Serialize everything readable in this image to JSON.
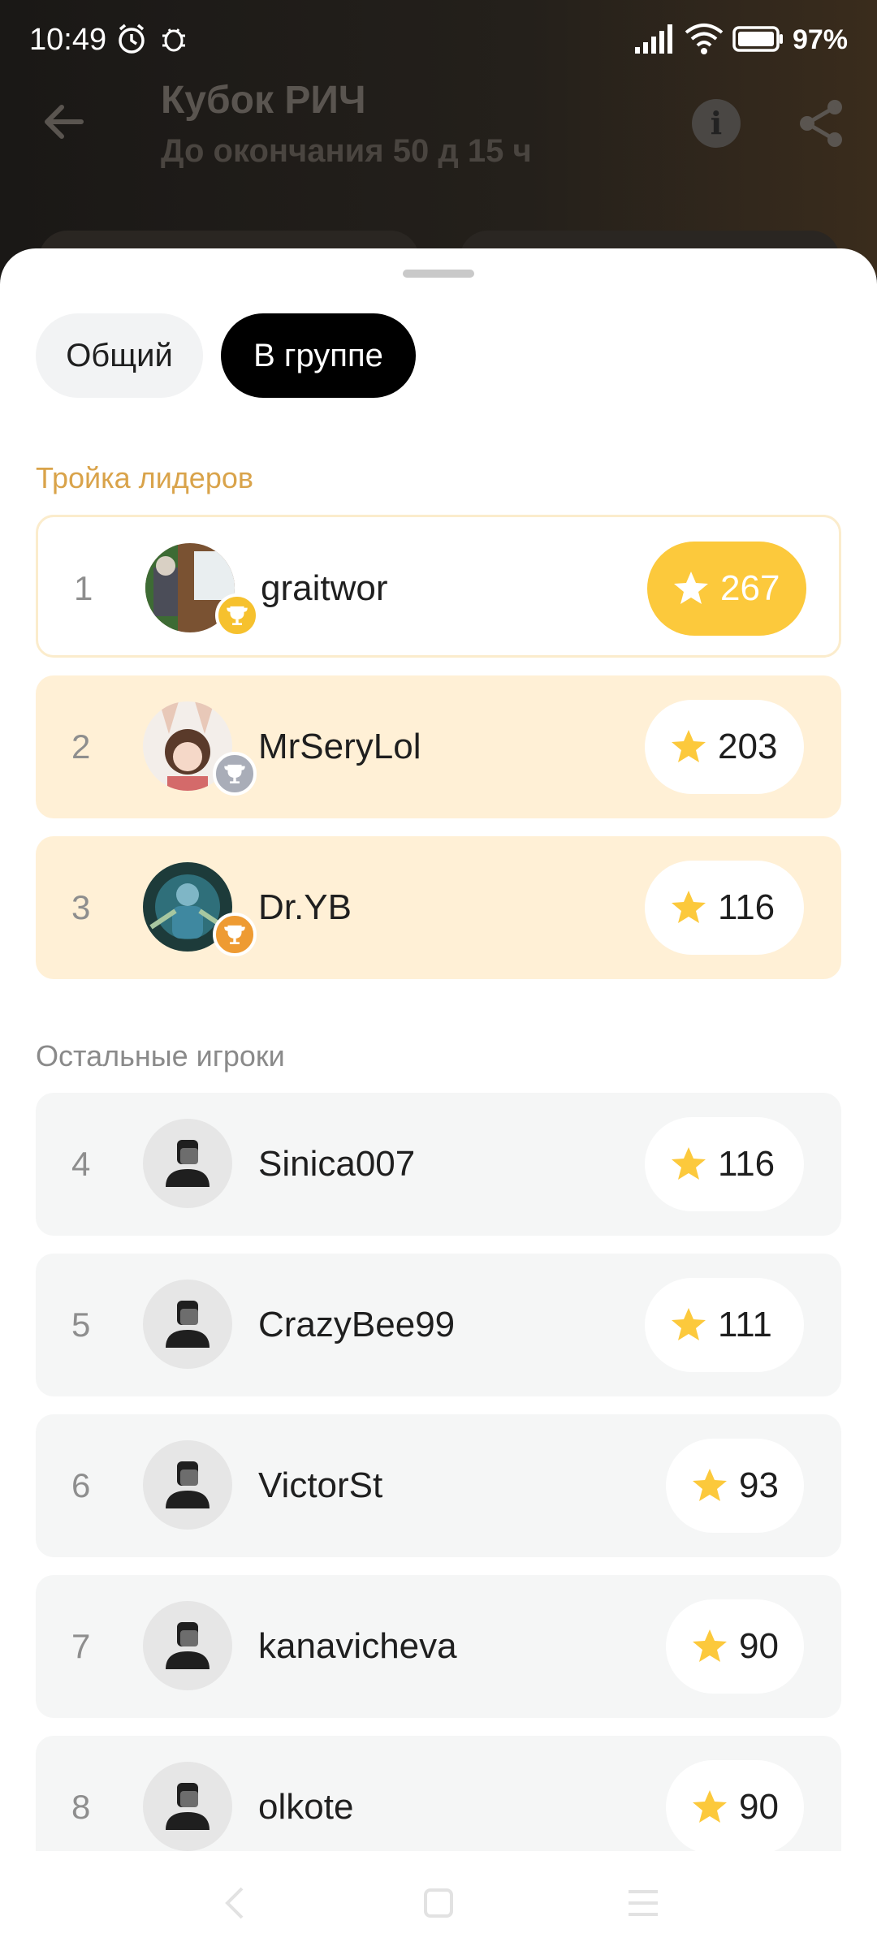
{
  "status_bar": {
    "time": "10:49",
    "battery": "97%"
  },
  "header": {
    "title": "Кубок РИЧ",
    "subtitle": "До окончания 50 д 15 ч"
  },
  "tabs": [
    {
      "label": "Общий",
      "selected": false
    },
    {
      "label": "В группе",
      "selected": true
    }
  ],
  "sections": {
    "leaders_title": "Тройка лидеров",
    "others_title": "Остальные игроки"
  },
  "leaders": [
    {
      "rank": "1",
      "name": "graitwor",
      "score": "267",
      "medal": "gold"
    },
    {
      "rank": "2",
      "name": "MrSeryLol",
      "score": "203",
      "medal": "silver"
    },
    {
      "rank": "3",
      "name": "Dr.YB",
      "score": "116",
      "medal": "bronze"
    }
  ],
  "others": [
    {
      "rank": "4",
      "name": "Sinica007",
      "score": "116"
    },
    {
      "rank": "5",
      "name": "CrazyBee99",
      "score": "111"
    },
    {
      "rank": "6",
      "name": "VictorSt",
      "score": "93"
    },
    {
      "rank": "7",
      "name": "kanavicheva",
      "score": "90"
    },
    {
      "rank": "8",
      "name": "olkote",
      "score": "90"
    }
  ],
  "colors": {
    "accent_gold": "#fcc93c",
    "leader_row": "#fff0d6",
    "section_gold": "#d9a34a"
  }
}
